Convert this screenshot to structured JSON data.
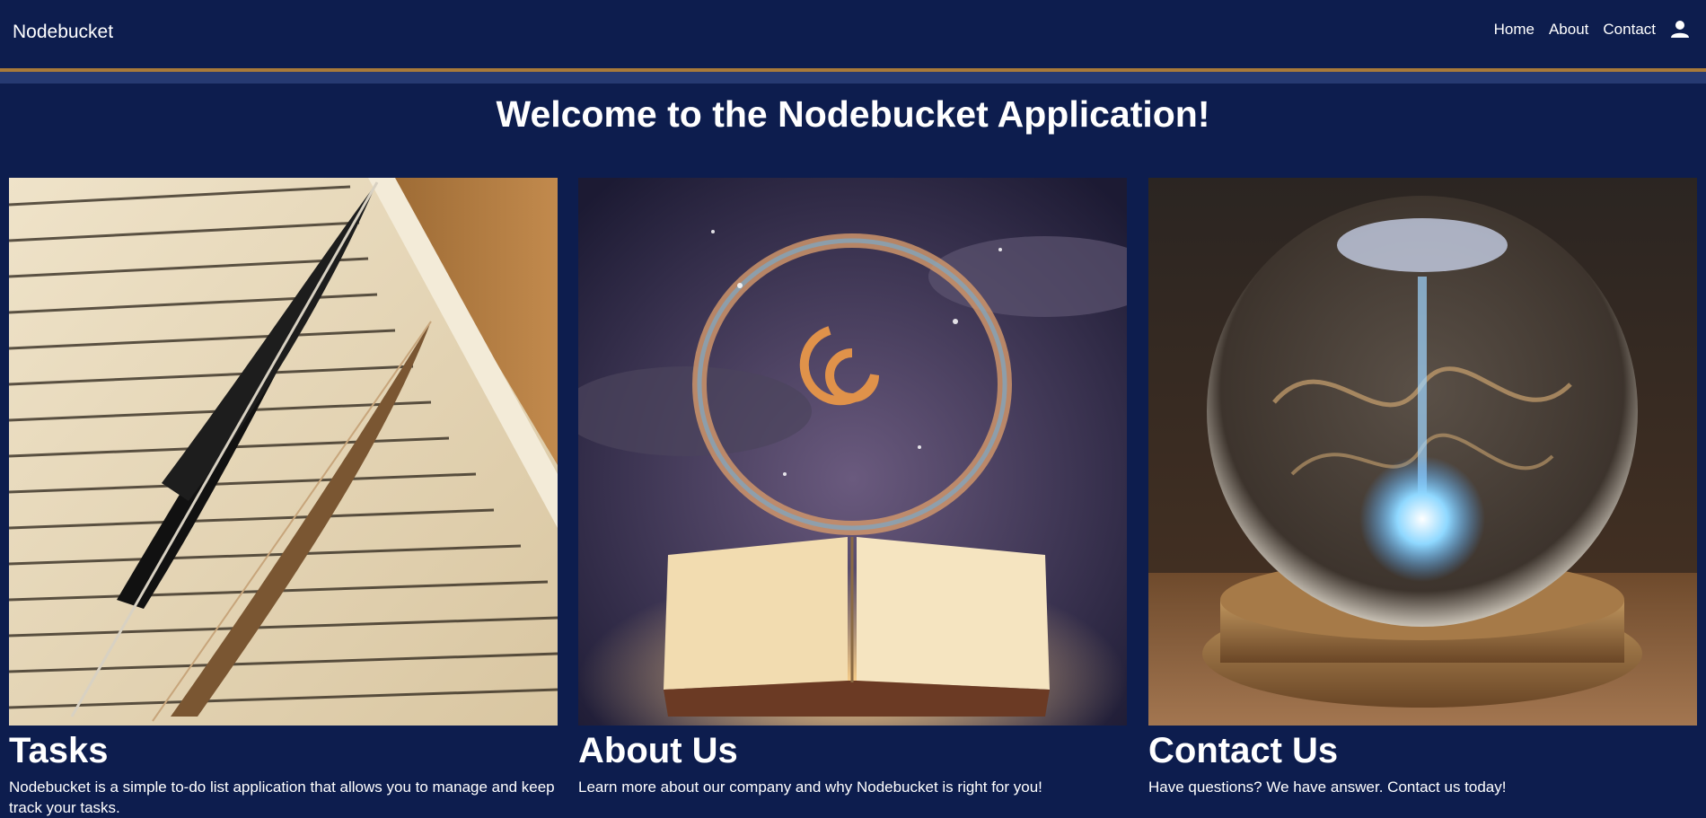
{
  "header": {
    "brand": "Nodebucket",
    "nav": [
      "Home",
      "About",
      "Contact"
    ],
    "user_icon": "user-icon"
  },
  "main": {
    "welcome": "Welcome to the Nodebucket Application!",
    "cards": [
      {
        "title": "Tasks",
        "text": "Nodebucket is a simple to-do list application that allows you to manage and keep track your tasks.",
        "image": "quill-on-open-book-illustration"
      },
      {
        "title": "About Us",
        "text": "Learn more about our company and why Nodebucket is right for you!",
        "image": "magic-open-book-illustration"
      },
      {
        "title": "Contact Us",
        "text": "Have questions? We have answer. Contact us today!",
        "image": "crystal-ball-illustration"
      }
    ]
  },
  "colors": {
    "background": "#0d1d4e",
    "accent_gold": "#a87a3a",
    "accent_blue": "#263a72",
    "text": "#ffffff"
  }
}
